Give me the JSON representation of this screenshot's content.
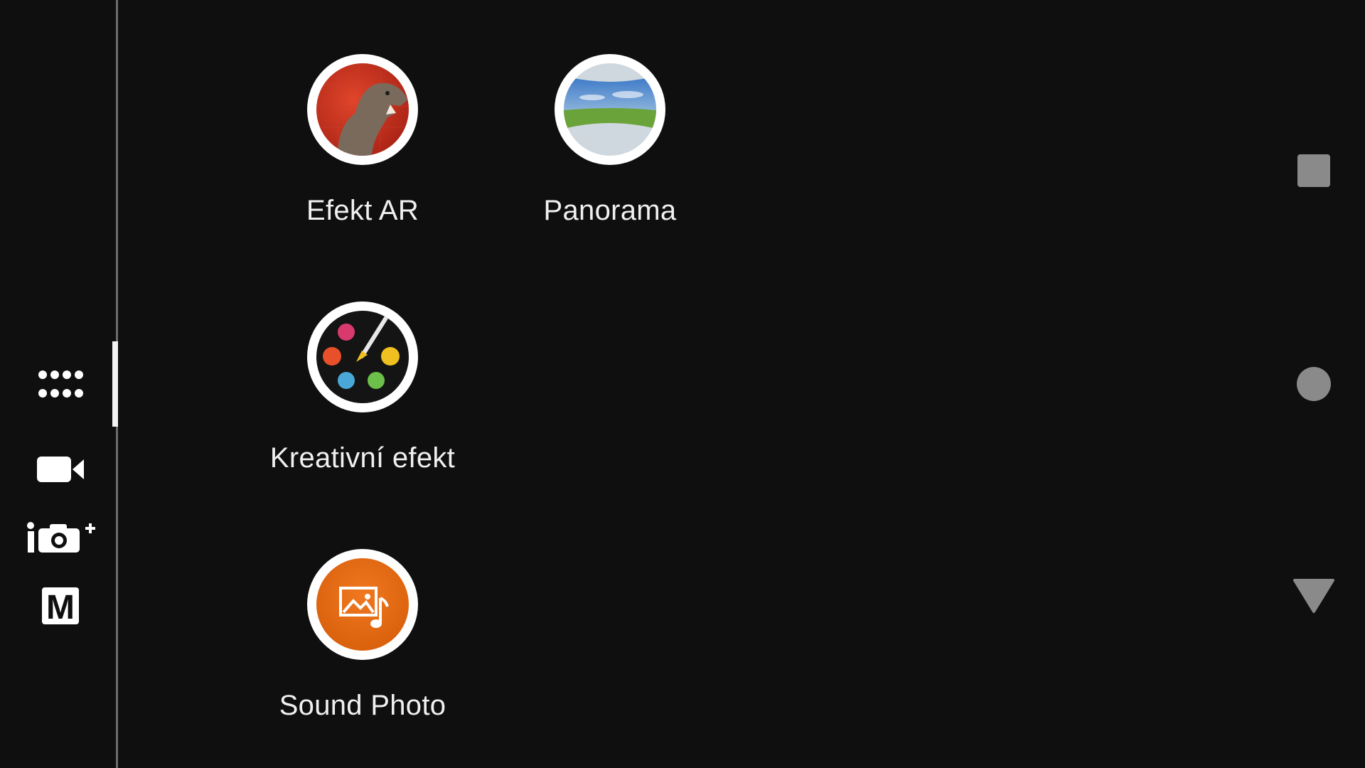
{
  "left_rail": {
    "items": [
      {
        "icon": "grid-apps-icon",
        "active": true
      },
      {
        "icon": "video-camera-icon",
        "active": false
      },
      {
        "icon": "superior-auto-camera-icon",
        "active": false
      },
      {
        "icon": "manual-mode-icon",
        "label": "M",
        "active": false
      }
    ]
  },
  "apps": [
    {
      "label": "Efekt AR",
      "icon": "ar-effect-dinosaur-icon"
    },
    {
      "label": "Panorama",
      "icon": "panorama-landscape-icon"
    },
    {
      "label": "Kreativní efekt",
      "icon": "creative-effect-palette-icon"
    },
    {
      "label": "Sound Photo",
      "icon": "sound-photo-icon"
    }
  ],
  "nav_bar": {
    "items": [
      {
        "icon": "recents-square-icon"
      },
      {
        "icon": "home-circle-icon"
      },
      {
        "icon": "back-triangle-icon"
      }
    ]
  },
  "colors": {
    "background": "#0f0f0f",
    "sound_photo_orange": "#e0650c",
    "nav_gray": "#8a8a8a"
  }
}
